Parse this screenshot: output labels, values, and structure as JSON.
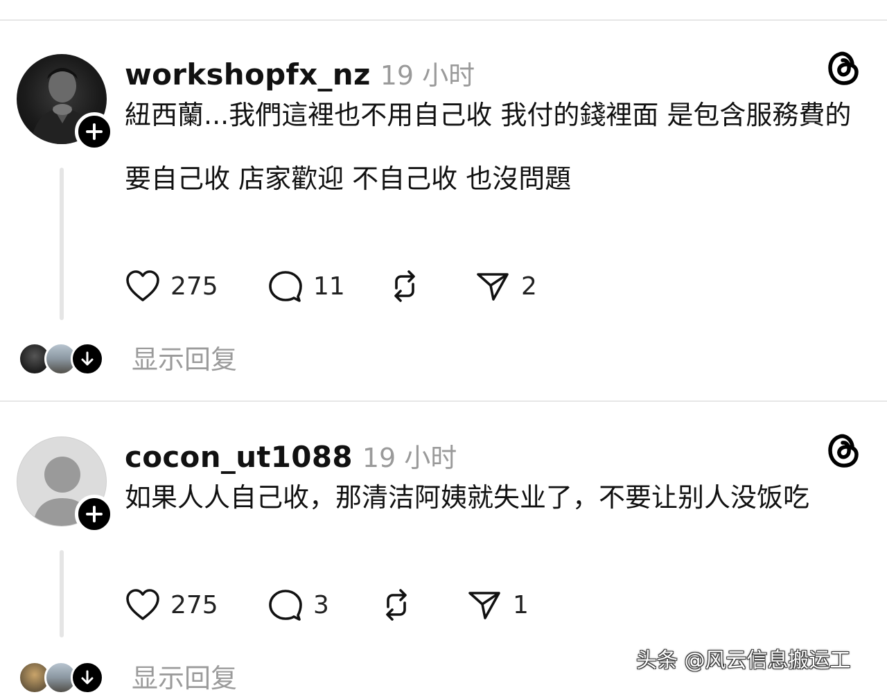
{
  "posts": [
    {
      "username": "workshopfx_nz",
      "time": "19 小时",
      "avatar_icon": "profile-photo",
      "text_lines": [
        "紐西蘭...我們這裡也不用自己收 我付的錢裡面 是包含服務費的",
        "要自己收 店家歡迎 不自己收 也沒問題"
      ],
      "likes": "275",
      "comments": "11",
      "shares": "2",
      "show_replies": "显示回复"
    },
    {
      "username": "cocon_ut1088",
      "time": "19 小时",
      "avatar_icon": "default-user-icon",
      "text_lines": [
        "如果人人自己收，那清洁阿姨就失业了，不要让别人没饭吃"
      ],
      "likes": "275",
      "comments": "3",
      "shares": "1",
      "show_replies": "显示回复"
    }
  ],
  "watermark": "头条 @风云信息搬运工"
}
